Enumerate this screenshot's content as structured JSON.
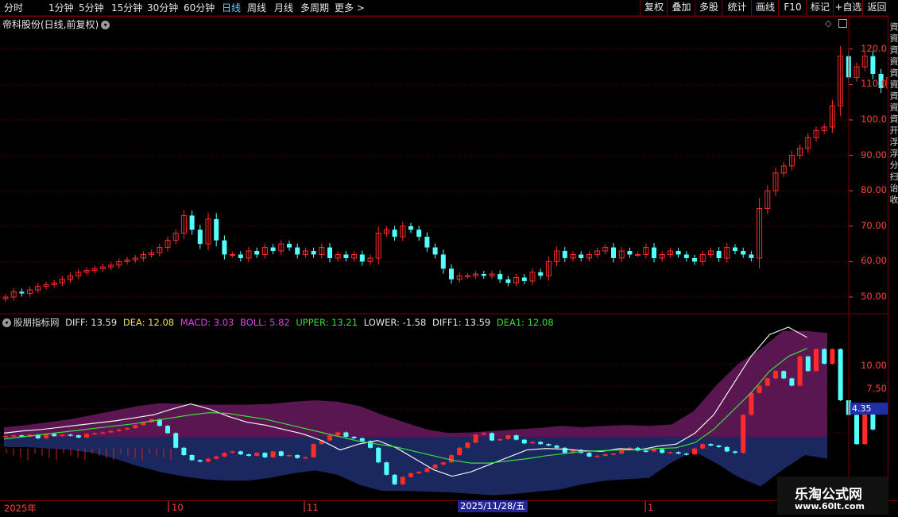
{
  "toolbar": {
    "periods": [
      "分时",
      "1分钟",
      "5分钟",
      "15分钟",
      "30分钟",
      "60分钟",
      "日线",
      "周线",
      "月线",
      "多周期",
      "更多 >"
    ],
    "active_period": "日线",
    "actions": [
      "复权",
      "叠加",
      "多股",
      "统计",
      "画线",
      "F10",
      "标记",
      "+自选",
      "返回"
    ]
  },
  "stock_title": "帝科股份(日线,前复权)",
  "price_axis": [
    "120.0",
    "110.0",
    "100.0",
    "90.00",
    "80.00",
    "70.00",
    "60.00",
    "50.00"
  ],
  "indicator": {
    "name": "股朋指标网",
    "items": [
      {
        "label": "DIFF: 13.59",
        "color": "#e8e8e8"
      },
      {
        "label": "DEA: 12.08",
        "color": "#f0e050"
      },
      {
        "label": "MACD: 3.03",
        "color": "#e040e0"
      },
      {
        "label": "BOLL: 5.82",
        "color": "#e040e0"
      },
      {
        "label": "UPPER: 13.21",
        "color": "#3cdc3c"
      },
      {
        "label": "LOWER: -1.58",
        "color": "#e8e8e8"
      },
      {
        "label": "DIFF1: 13.59",
        "color": "#e8e8e8"
      },
      {
        "label": "DEA1: 12.08",
        "color": "#3cdc3c"
      }
    ]
  },
  "indicator_axis": [
    "10.00",
    "7.50"
  ],
  "indicator_value_box": "4.35",
  "date_axis": [
    "2025年",
    "10",
    "11",
    "1"
  ],
  "date_cursor": "2025/11/28/五",
  "right_strip_text": "資 資 資 資 資 資 資 資 資 开 浮 浮 分 扫 诒 收",
  "logo": {
    "line1": "乐淘公式网",
    "line2": "www.60lt.com"
  },
  "colors": {
    "up": "#ff2a2a",
    "down": "#54ffff",
    "axis": "#ff4040",
    "grid": "#7a0000",
    "band": "#5a1650",
    "lower_band": "#1b2860"
  }
}
